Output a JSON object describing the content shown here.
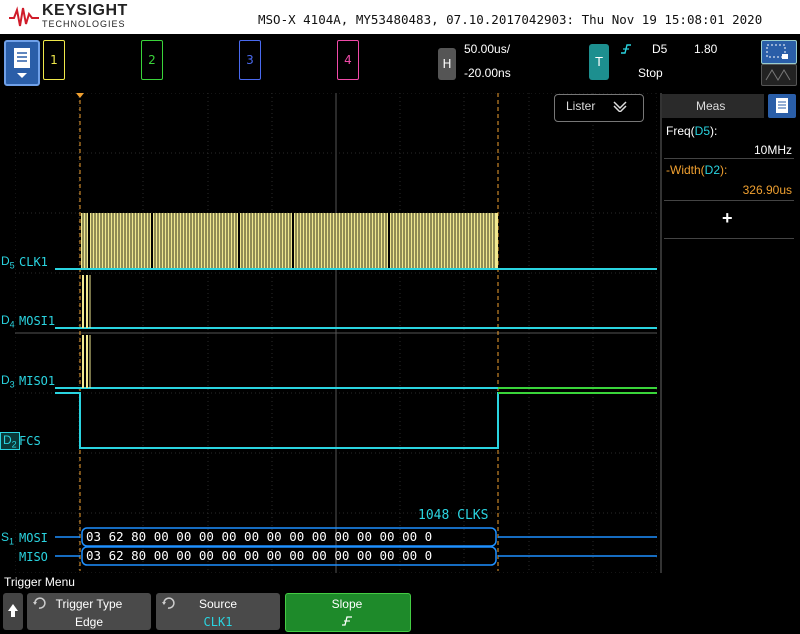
{
  "header": {
    "brand": "KEYSIGHT",
    "brand_sub": "TECHNOLOGIES",
    "model_info": "MSO-X 4104A, MY53480483, 07.10.2017042903: Thu Nov 19 15:08:01 2020"
  },
  "channels": [
    {
      "label": "1",
      "color": "#f0e84a"
    },
    {
      "label": "2",
      "color": "#3ad43a"
    },
    {
      "label": "3",
      "color": "#4a6af0"
    },
    {
      "label": "4",
      "color": "#f04aa8"
    }
  ],
  "horizontal": {
    "button": "H",
    "timebase": "50.00us/",
    "delay": "-20.00ns"
  },
  "trigger": {
    "button": "T",
    "source": "D5",
    "level": "1.80",
    "status": "Stop"
  },
  "lister": {
    "label": "Lister"
  },
  "meas": {
    "title": "Meas",
    "items": [
      {
        "name_prefix": "Freq(",
        "source": "D5",
        "name_suffix": "):",
        "value": "10MHz",
        "color": "#ffffff"
      },
      {
        "name_prefix": "-Width(",
        "source": "D2",
        "name_suffix": "):",
        "value": "326.90us",
        "color": "#f0a030"
      }
    ],
    "add": "+"
  },
  "traces": [
    {
      "prefix": "D",
      "sub": "5",
      "name": "CLK1"
    },
    {
      "prefix": "D",
      "sub": "4",
      "name": "MOSI1"
    },
    {
      "prefix": "D",
      "sub": "3",
      "name": "MISO1"
    },
    {
      "prefix": "D",
      "sub": "2",
      "name": "FCS"
    }
  ],
  "serial": {
    "prefix": "S",
    "sub": "1",
    "clk_count": "1048 CLKS",
    "mosi_label": "MOSI",
    "miso_label": "MISO",
    "mosi_bytes": "03 62 80 00 00 00 00 00 00 00 00 00 00 00 00 0",
    "miso_bytes": "03 62 80 00 00 00 00 00 00 00 00 00 00 00 00 0"
  },
  "softkeys": {
    "menu_title": "Trigger Menu",
    "trigger_type_label": "Trigger Type",
    "trigger_type_value": "Edge",
    "source_label": "Source",
    "source_value": "CLK1",
    "slope_label": "Slope",
    "slope_value": "∱"
  },
  "colors": {
    "trace": "#2ad4e0",
    "clk_burst": "#f0e890",
    "cursor": "#f0a030",
    "serial": "#1e90ff"
  }
}
